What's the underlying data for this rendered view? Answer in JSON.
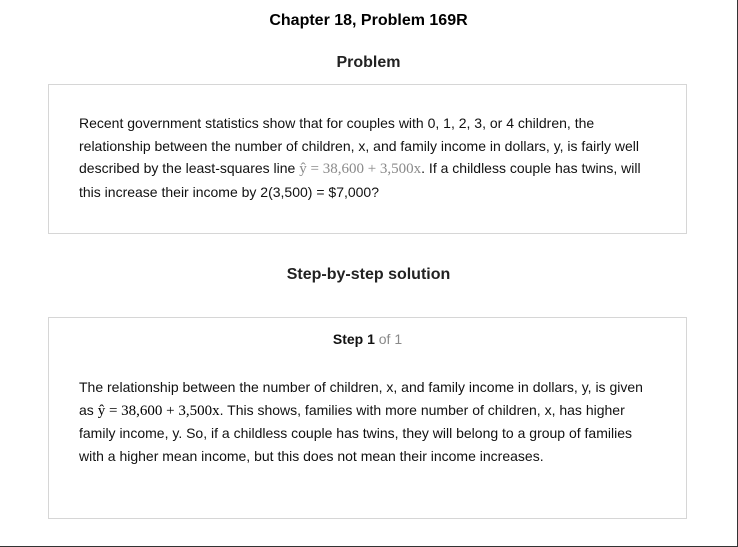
{
  "page": {
    "title": "Chapter 18, Problem 169R"
  },
  "problem": {
    "heading": "Problem",
    "text_before_equation": "Recent government statistics show that for couples with 0, 1, 2, 3, or 4 children, the relationship between the number of children, x, and family income in dollars, y, is fairly well described by the least-squares line ",
    "equation": "ŷ = 38,600 + 3,500x",
    "text_after_equation": ". If a childless couple has twins, will this increase their income by 2(3,500) = $7,000?"
  },
  "solution": {
    "heading": "Step-by-step solution",
    "step_label": "Step 1",
    "step_count": "of 1",
    "text_before_equation": "The relationship between the number of children, x, and family income in dollars, y, is given as  ",
    "equation": "ŷ = 38,600 + 3,500x",
    "text_after_equation": ". This shows, families with more number of children, x, has higher family income, y. So, if a childless couple has twins, they will belong to a group of families with a higher mean income, but this does not mean their income increases."
  },
  "colors": {
    "card_border": "#d6d6d6",
    "muted_text": "#8a8a8a"
  }
}
